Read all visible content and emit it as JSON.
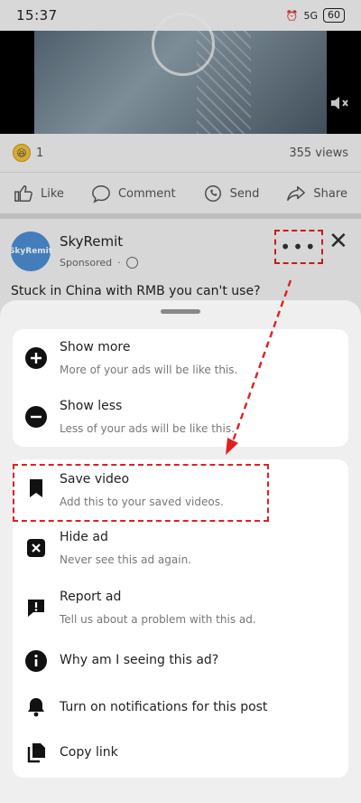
{
  "status": {
    "time": "15:37",
    "network": "5G",
    "battery": "60"
  },
  "post_stats": {
    "reaction_count": "1",
    "views": "355 views"
  },
  "actions": [
    {
      "label": "Like",
      "icon": "like-icon"
    },
    {
      "label": "Comment",
      "icon": "comment-icon"
    },
    {
      "label": "Send",
      "icon": "whatsapp-icon"
    },
    {
      "label": "Share",
      "icon": "share-icon"
    }
  ],
  "post": {
    "avatar_text": "SkyRemit",
    "name": "SkyRemit",
    "sponsored": "Sponsored",
    "text": "Stuck in China with RMB you can't use?"
  },
  "menu": {
    "group1": [
      {
        "title": "Show more",
        "subtitle": "More of your ads will be like this.",
        "icon": "plus-circle-icon"
      },
      {
        "title": "Show less",
        "subtitle": "Less of your ads will be like this.",
        "icon": "minus-circle-icon"
      }
    ],
    "group2": [
      {
        "title": "Save video",
        "subtitle": "Add this to your saved videos.",
        "icon": "bookmark-icon"
      },
      {
        "title": "Hide ad",
        "subtitle": "Never see this ad again.",
        "icon": "hide-icon"
      },
      {
        "title": "Report ad",
        "subtitle": "Tell us about a problem with this ad.",
        "icon": "report-icon"
      },
      {
        "title": "Why am I seeing this ad?",
        "subtitle": "",
        "icon": "info-icon"
      },
      {
        "title": "Turn on notifications for this post",
        "subtitle": "",
        "icon": "bell-icon"
      },
      {
        "title": "Copy link",
        "subtitle": "",
        "icon": "copy-icon"
      }
    ]
  },
  "colors": {
    "annotation": "#e02020",
    "accent": "#4d8fd6"
  }
}
